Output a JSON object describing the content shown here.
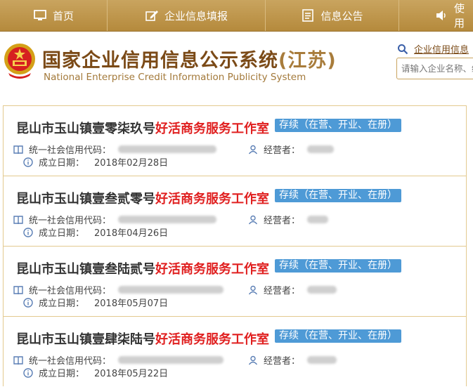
{
  "nav": {
    "items": [
      {
        "label": "首页",
        "icon": "monitor-icon"
      },
      {
        "label": "企业信息填报",
        "icon": "edit-icon"
      },
      {
        "label": "信息公告",
        "icon": "notice-icon"
      },
      {
        "label": "使用",
        "icon": "speaker-icon"
      }
    ]
  },
  "header": {
    "title_main": "国家企业信用信息公示系统",
    "title_province": "(江苏)",
    "title_en": "National Enterprise Credit Information Publicity System",
    "search_link": "企业信用信息",
    "search_placeholder": "请输入企业名称、统"
  },
  "results": [
    {
      "name_prefix": "昆山市玉山镇壹零柒玖号",
      "name_highlight": "好活商务服务工作室",
      "status": "存续（在营、开业、在册）",
      "credit_code_label": "统一社会信用代码：",
      "operator_label": "经营者：",
      "date_label": "成立日期：",
      "date": "2018年02月28日"
    },
    {
      "name_prefix": "昆山市玉山镇壹叁贰零号",
      "name_highlight": "好活商务服务工作室",
      "status": "存续（在营、开业、在册）",
      "credit_code_label": "统一社会信用代码：",
      "operator_label": "经营者：",
      "date_label": "成立日期：",
      "date": "2018年04月26日"
    },
    {
      "name_prefix": "昆山市玉山镇壹叁陆贰号",
      "name_highlight": "好活商务服务工作室",
      "status": "存续（在营、开业、在册）",
      "credit_code_label": "统一社会信用代码：",
      "operator_label": "经营者：",
      "date_label": "成立日期：",
      "date": "2018年05月07日"
    },
    {
      "name_prefix": "昆山市玉山镇壹肆柒陆号",
      "name_highlight": "好活商务服务工作室",
      "status": "存续（在营、开业、在册）",
      "credit_code_label": "统一社会信用代码：",
      "operator_label": "经营者：",
      "date_label": "成立日期：",
      "date": "2018年05月22日"
    }
  ],
  "colors": {
    "nav_bg": "#b58a3c",
    "title": "#7b4a17",
    "highlight": "#e02020",
    "badge": "#4e9ad6",
    "card_border": "#e3c98f"
  }
}
